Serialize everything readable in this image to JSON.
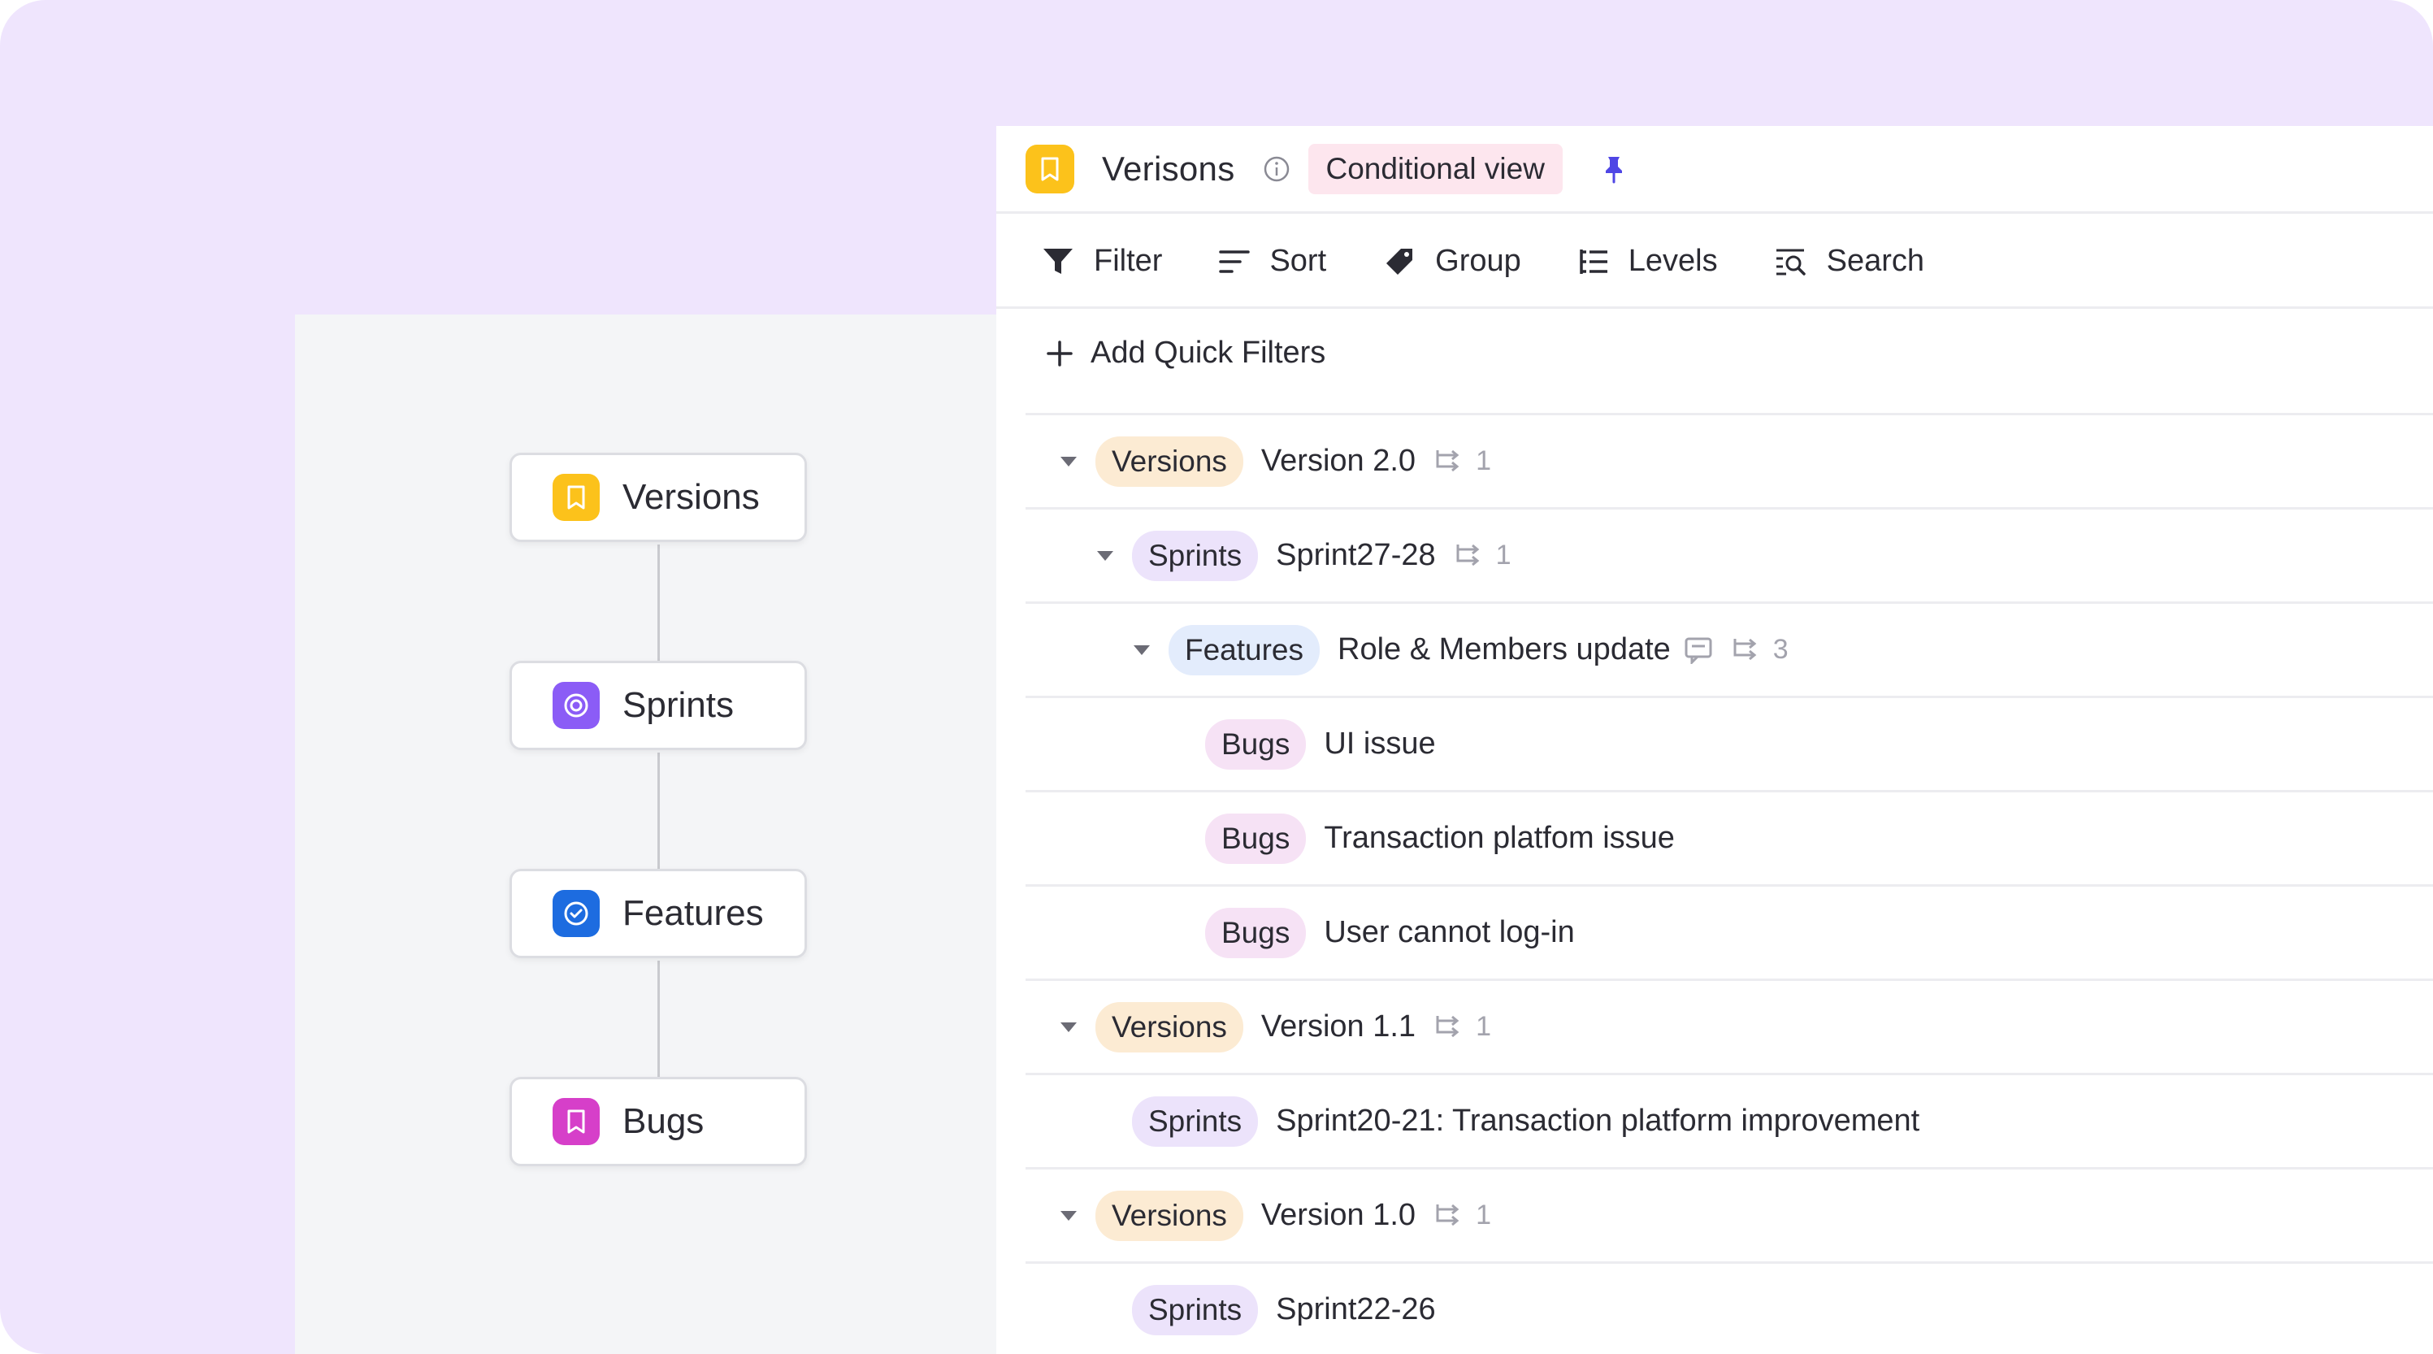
{
  "hierarchy": {
    "nodes": [
      {
        "label": "Versions",
        "icon": "bookmark-icon",
        "color": "#fcc21b"
      },
      {
        "label": "Sprints",
        "icon": "sprint-cycle-icon",
        "color": "#8b5cf6"
      },
      {
        "label": "Features",
        "icon": "check-circle-icon",
        "color": "#1d6ce0"
      },
      {
        "label": "Bugs",
        "icon": "bookmark-icon",
        "color": "#d63fc9"
      }
    ]
  },
  "view": {
    "title": "Verisons",
    "icon": "bookmark-icon",
    "icon_color": "#fcc21b",
    "badge": "Conditional view",
    "pin_color": "#4f46e5"
  },
  "toolbar": {
    "filter": "Filter",
    "sort": "Sort",
    "group": "Group",
    "levels": "Levels",
    "search": "Search"
  },
  "quick_filters": {
    "label": "Add Quick Filters"
  },
  "rows": [
    {
      "type": "Versions",
      "title": "Version 2.0",
      "children": "1",
      "expanded": true
    },
    {
      "type": "Sprints",
      "title": "Sprint27-28",
      "children": "1",
      "expanded": true
    },
    {
      "type": "Features",
      "title": "Role & Members update",
      "children": "3",
      "expanded": true,
      "has_comment": true
    },
    {
      "type": "Bugs",
      "title": "UI issue"
    },
    {
      "type": "Bugs",
      "title": "Transaction platfom issue"
    },
    {
      "type": "Bugs",
      "title": "User cannot log-in"
    },
    {
      "type": "Versions",
      "title": "Version 1.1",
      "children": "1",
      "expanded": true
    },
    {
      "type": "Sprints",
      "title": "Sprint20-21: Transaction platform improvement"
    },
    {
      "type": "Versions",
      "title": "Version 1.0",
      "children": "1",
      "expanded": true
    },
    {
      "type": "Sprints",
      "title": "Sprint22-26"
    }
  ]
}
